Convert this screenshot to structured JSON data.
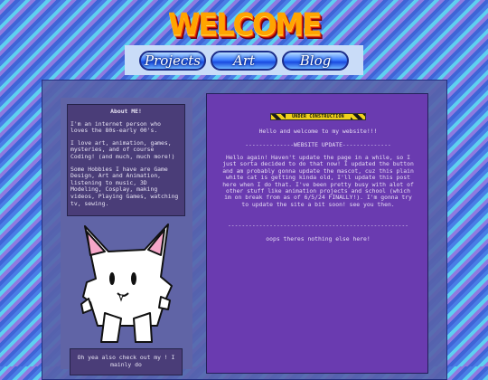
{
  "header": {
    "title": "WELCOME"
  },
  "nav": {
    "items": [
      "Projects",
      "Art",
      "Blog"
    ]
  },
  "about": {
    "heading": "About ME!",
    "p1": "I'm an internet person who loves the 80s-early 00's.",
    "p2": "I love art, animation, games, mysteries, and of course Coding! (and much, much more!)",
    "p3": "Some Hobbies I have are Game Design, Art and Animation, listening to music, 3D Modeling, Cosplay, making videos, Playing Games, watching tv, sewing."
  },
  "checkout": {
    "text": "Oh yea also check out my !  I mainly do"
  },
  "main": {
    "badge": "UNDER CONSTRUCTION",
    "welcome": "Hello and welcome to my website!!!",
    "update_heading": "--------------WEBSITE UPDATE--------------",
    "update_body": "Hello again! Haven't update the page in a while, so I just sorta decided to do that now! I updated the button and am probably gonna update the mascot, cuz this plain white cat is getting kinda old, I'll update this post here when I do that. I've been pretty busy with alot of other stuff like animation projects and school (which im on break from as of 6/5/24 FINALLY!). I'm gonna try to update the site a bit soon! see you then.",
    "divider": "----------------------------------------------------",
    "end_text": "oops theres nothing else here!"
  },
  "colors": {
    "title": "#ffa400",
    "panel": "#6a3bb0",
    "nav_bg": "#c9dcf8"
  },
  "icons": {
    "mascot": "white-cat-mascot-icon",
    "badge": "under-construction-icon"
  }
}
